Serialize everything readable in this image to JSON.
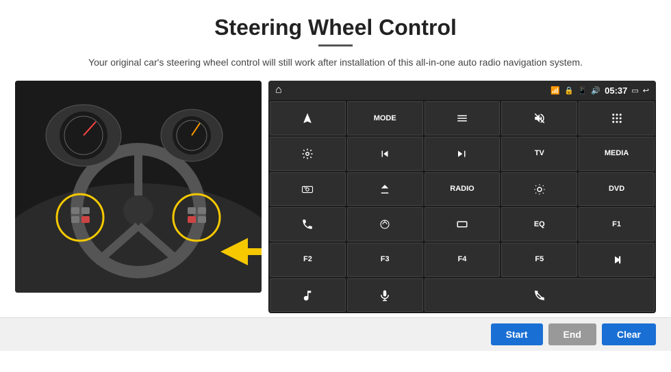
{
  "page": {
    "title": "Steering Wheel Control",
    "subtitle": "Your original car's steering wheel control will still work after installation of this all-in-one auto radio navigation system.",
    "divider": true
  },
  "status_bar": {
    "time": "05:37",
    "icons": [
      "wifi",
      "lock",
      "sim",
      "bluetooth",
      "screen",
      "back"
    ]
  },
  "grid_buttons": [
    {
      "id": "r0c0",
      "icon": "navigate",
      "text": ""
    },
    {
      "id": "r0c1",
      "icon": "",
      "text": "MODE"
    },
    {
      "id": "r0c2",
      "icon": "menu",
      "text": ""
    },
    {
      "id": "r0c3",
      "icon": "mute",
      "text": ""
    },
    {
      "id": "r0c4",
      "icon": "apps",
      "text": ""
    },
    {
      "id": "r1c0",
      "icon": "settings-circle",
      "text": ""
    },
    {
      "id": "r1c1",
      "icon": "prev",
      "text": ""
    },
    {
      "id": "r1c2",
      "icon": "next",
      "text": ""
    },
    {
      "id": "r1c3",
      "icon": "",
      "text": "TV"
    },
    {
      "id": "r1c4",
      "icon": "",
      "text": "MEDIA"
    },
    {
      "id": "r2c0",
      "icon": "360-cam",
      "text": ""
    },
    {
      "id": "r2c1",
      "icon": "eject",
      "text": ""
    },
    {
      "id": "r2c2",
      "icon": "",
      "text": "RADIO"
    },
    {
      "id": "r2c3",
      "icon": "brightness",
      "text": ""
    },
    {
      "id": "r2c4",
      "icon": "",
      "text": "DVD"
    },
    {
      "id": "r3c0",
      "icon": "phone",
      "text": ""
    },
    {
      "id": "r3c1",
      "icon": "swipe",
      "text": ""
    },
    {
      "id": "r3c2",
      "icon": "rect",
      "text": ""
    },
    {
      "id": "r3c3",
      "icon": "",
      "text": "EQ"
    },
    {
      "id": "r3c4",
      "icon": "",
      "text": "F1"
    },
    {
      "id": "r4c0",
      "icon": "",
      "text": "F2"
    },
    {
      "id": "r4c1",
      "icon": "",
      "text": "F3"
    },
    {
      "id": "r4c2",
      "icon": "",
      "text": "F4"
    },
    {
      "id": "r4c3",
      "icon": "",
      "text": "F5"
    },
    {
      "id": "r4c4",
      "icon": "play-pause",
      "text": ""
    },
    {
      "id": "r5c0",
      "icon": "music",
      "text": ""
    },
    {
      "id": "r5c1",
      "icon": "mic",
      "text": ""
    },
    {
      "id": "r5c2",
      "icon": "phone-end",
      "text": ""
    }
  ],
  "bottom_buttons": {
    "start": "Start",
    "end": "End",
    "clear": "Clear"
  }
}
